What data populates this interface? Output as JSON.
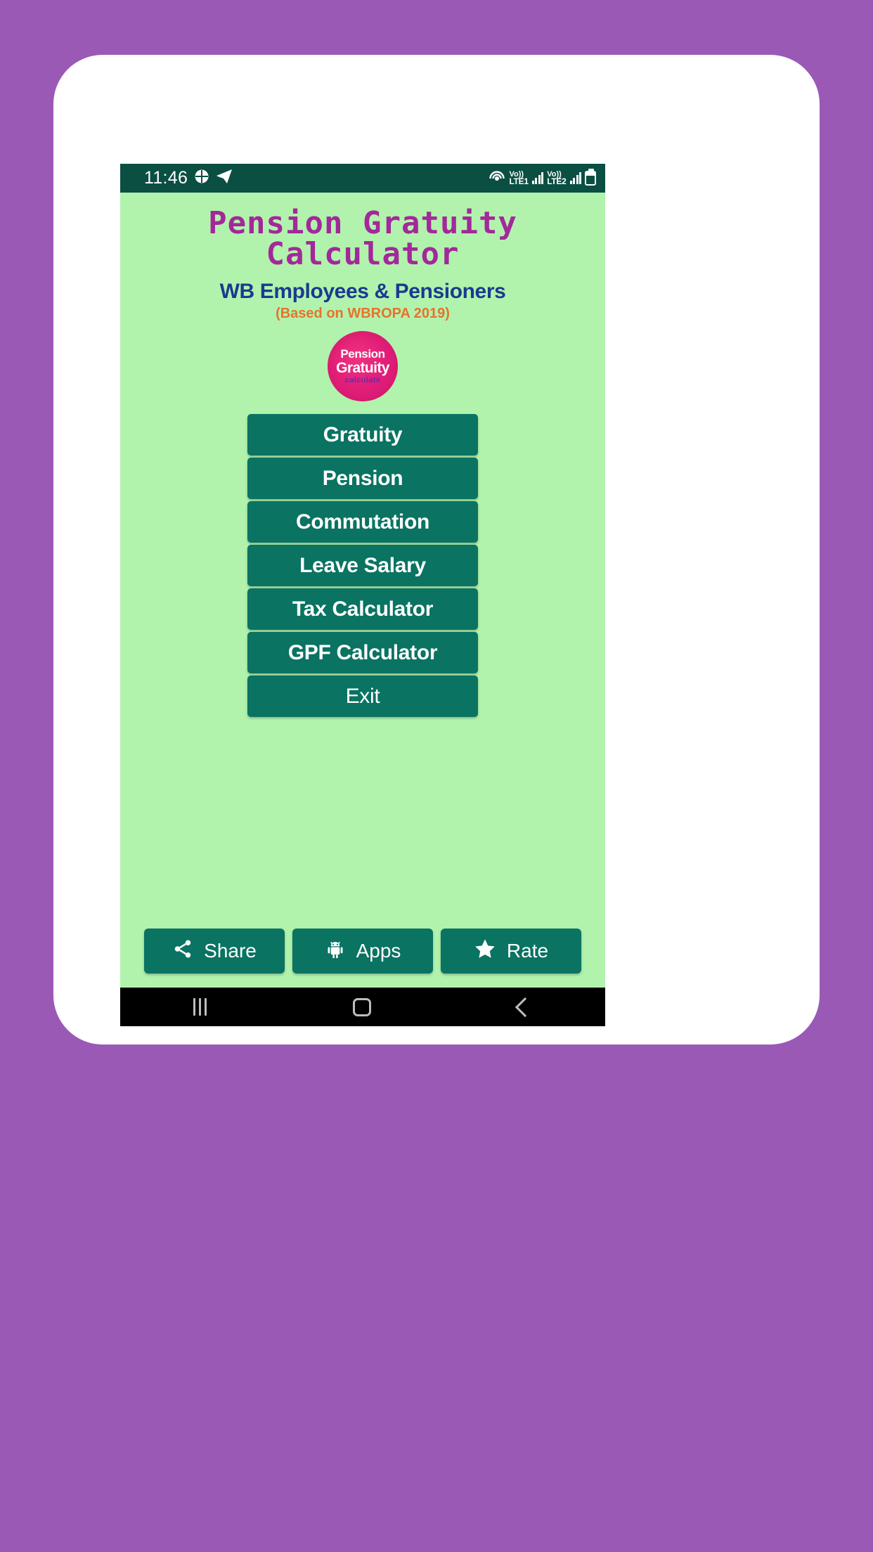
{
  "device": {
    "status_bar": {
      "clock": "11:46",
      "left_icons": [
        "app-badge-icon",
        "telegram-icon"
      ],
      "right_icons": [
        "hotspot-icon",
        "volte1-icon",
        "signal-bars-1-icon",
        "volte2-icon",
        "signal-bars-2-icon",
        "battery-icon"
      ],
      "volte1_top": "Vo))",
      "volte1_bottom": "LTE1",
      "volte2_top": "Vo))",
      "volte2_bottom": "LTE2",
      "background_color": "#0a4f42"
    },
    "nav_bar": {
      "recents_label": "recents-icon",
      "home_label": "home-icon",
      "back_label": "back-icon",
      "background_color": "#000000"
    },
    "frame_color": "#ffffff",
    "page_background_color": "#9b59b6"
  },
  "app": {
    "background_color": "#b1f3ad",
    "title": "Pension Gratuity Calculator",
    "title_color": "#a3289a",
    "subtitle": "WB Employees & Pensioners",
    "subtitle_color": "#1b3a8f",
    "basis_note": "(Based on WBROPA 2019)",
    "basis_note_color": "#e8722c",
    "logo": {
      "line1": "Pension",
      "line2": "Gratuity",
      "line3": "calculate",
      "circle_color": "#e3207a"
    },
    "menu": {
      "button_color": "#0a7362",
      "items": [
        {
          "label": "Gratuity",
          "name": "gratuity",
          "style": "bold"
        },
        {
          "label": "Pension",
          "name": "pension",
          "style": "bold"
        },
        {
          "label": "Commutation",
          "name": "commutation",
          "style": "bold"
        },
        {
          "label": "Leave Salary",
          "name": "leave-salary",
          "style": "bold"
        },
        {
          "label": "Tax Calculator",
          "name": "tax-calculator",
          "style": "bold"
        },
        {
          "label": "GPF Calculator",
          "name": "gpf-calculator",
          "style": "bold"
        },
        {
          "label": "Exit",
          "name": "exit",
          "style": "plain"
        }
      ]
    },
    "action_bar": {
      "share": {
        "label": "Share",
        "icon": "share-icon"
      },
      "apps": {
        "label": "Apps",
        "icon": "android-robot-icon"
      },
      "rate": {
        "label": "Rate",
        "icon": "star-icon"
      }
    }
  }
}
